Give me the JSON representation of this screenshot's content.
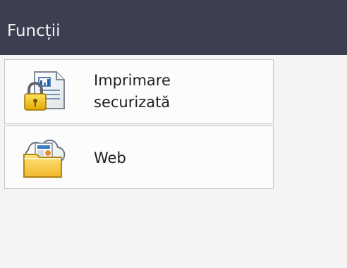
{
  "header": {
    "title": "Funcții"
  },
  "menu": {
    "items": [
      {
        "label_line1": "Imprimare",
        "label_line2": "securizată",
        "icon": "secure-print-icon"
      },
      {
        "label": "Web",
        "icon": "web-folder-icon"
      }
    ]
  },
  "colors": {
    "title_bar": "#3d3f50",
    "title_text": "#f2f2f2",
    "item_background": "#fcfcfc",
    "item_border": "#c6c6c6",
    "lock": "#f0c11d",
    "folder": "#f6c94a",
    "document_blue": "#245a9e"
  }
}
